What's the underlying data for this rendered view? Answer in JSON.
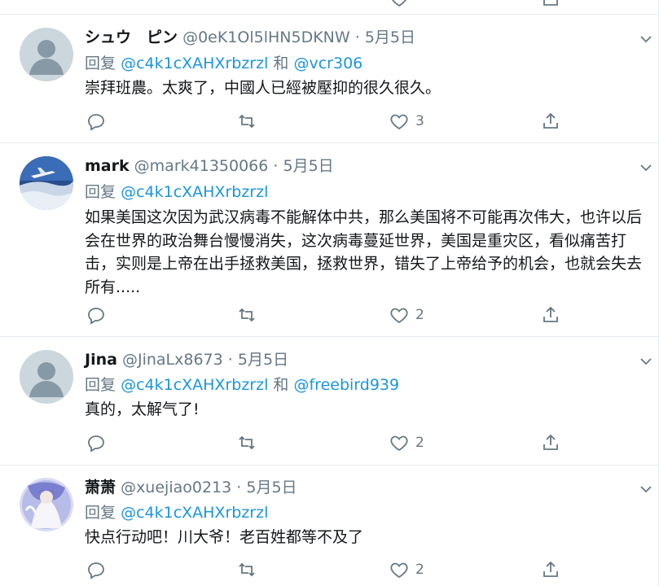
{
  "colors": {
    "link": "#1b95e0",
    "secondary": "#657786",
    "icon": "#657786",
    "border": "#e6ecf0"
  },
  "tweets": [
    {
      "display_name": "シュウ　ピン",
      "handle": "@0eK1Ol5lHN5DKNW",
      "date": "5月5日",
      "reply_prefix": "回复",
      "reply_to_1": "@c4k1cXAHXrbzrzl",
      "reply_join": "和",
      "reply_to_2": "@vcr306",
      "text": "崇拜班農。太爽了，中國人已經被壓抑的很久很久。",
      "likes": "3",
      "avatar": "default-avatar"
    },
    {
      "display_name": "mark",
      "handle": "@mark41350066",
      "date": "5月5日",
      "reply_prefix": "回复",
      "reply_to_1": "@c4k1cXAHXrbzrzl",
      "text": "如果美国这次因为武汉病毒不能解体中共，那么美国将不可能再次伟大，也许以后会在世界的政治舞台慢慢消失，这次病毒蔓延世界，美国是重灾区，看似痛苦打击，实则是上帝在出手拯救美国，拯救世界，错失了上帝给予的机会，也就会失去所有.....",
      "likes": "2",
      "avatar": "airplane-photo-avatar"
    },
    {
      "display_name": "Jina",
      "handle": "@JinaLx8673",
      "date": "5月5日",
      "reply_prefix": "回复",
      "reply_to_1": "@c4k1cXAHXrbzrzl",
      "reply_join": "和",
      "reply_to_2": "@freebird939",
      "text": "真的，太解气了!",
      "likes": "2",
      "avatar": "default-avatar"
    },
    {
      "display_name": "萧萧",
      "handle": "@xuejiao0213",
      "date": "5月5日",
      "reply_prefix": "回复",
      "reply_to_1": "@c4k1cXAHXrbzrzl",
      "text": "快点行动吧！川大爷！老百姓都等不及了",
      "likes": "2",
      "avatar": "anime-figure-avatar"
    }
  ],
  "dot": "·"
}
